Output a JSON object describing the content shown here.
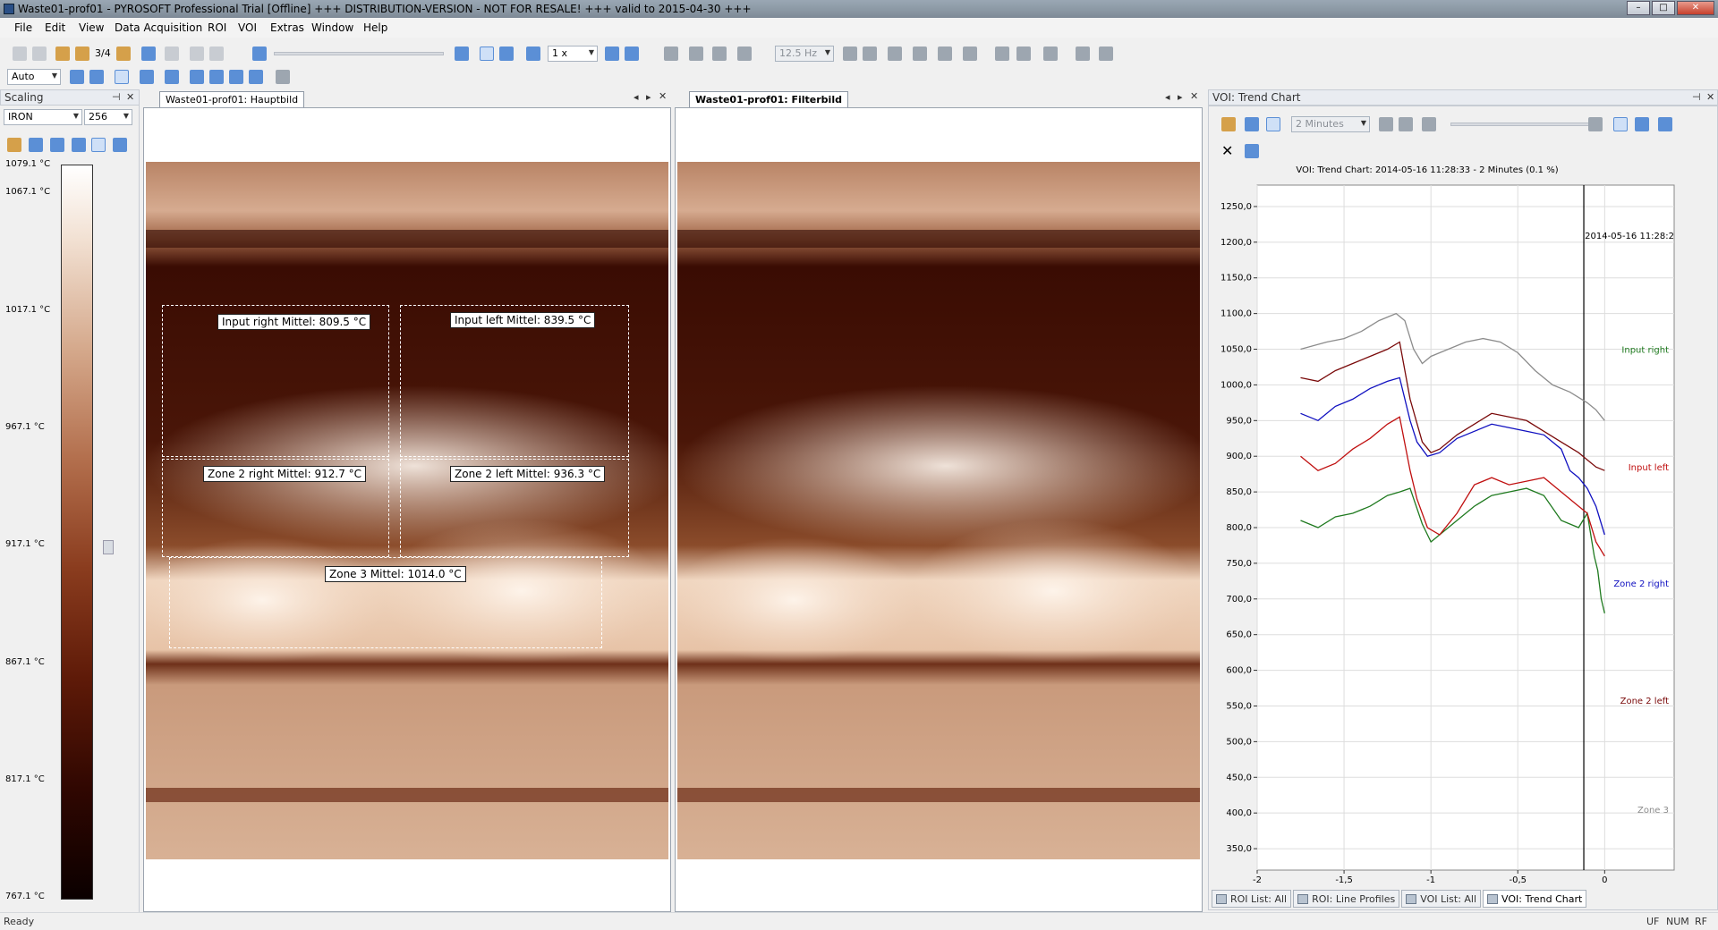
{
  "window": {
    "title": "Waste01-prof01 - PYROSOFT Professional Trial [Offline] +++ DISTRIBUTION-VERSION - NOT FOR RESALE! +++ valid to 2015-04-30 +++"
  },
  "menu": [
    "File",
    "Edit",
    "View",
    "Data Acquisition",
    "ROI",
    "VOI",
    "Extras",
    "Window",
    "Help"
  ],
  "toolbar": {
    "frame_counter": "3/4",
    "speed": "1 x",
    "rate": "12.5 Hz",
    "zoom_mode": "Auto"
  },
  "scaling": {
    "title": "Scaling",
    "palette": "IRON",
    "levels": "256",
    "ticks": [
      "1079.1 °C",
      "1067.1 °C",
      "1017.1 °C",
      "967.1 °C",
      "917.1 °C",
      "867.1 °C",
      "817.1 °C",
      "767.1 °C"
    ]
  },
  "views": {
    "main_tab": "Waste01-prof01: Hauptbild",
    "filter_tab": "Waste01-prof01: Filterbild"
  },
  "rois": [
    {
      "label": "Input right Mittel: 809.5 °C"
    },
    {
      "label": "Input left Mittel: 839.5 °C"
    },
    {
      "label": "Zone 2 right Mittel: 912.7 °C"
    },
    {
      "label": "Zone 2 left Mittel: 936.3 °C"
    },
    {
      "label": "Zone 3 Mittel: 1014.0 °C"
    }
  ],
  "trend": {
    "panel_title": "VOI: Trend Chart",
    "interval": "2 Minutes"
  },
  "chart_data": {
    "type": "line",
    "title": "VOI: Trend Chart: 2014-05-16 11:28:33 - 2 Minutes (0.1 %)",
    "cursor_label": "2014-05-16 11:28:2",
    "cursor_x": -0.12,
    "xlim": [
      -2,
      0.4
    ],
    "ylim": [
      320,
      1280
    ],
    "x_ticks": [
      "-2",
      "-1,5",
      "-1",
      "-0,5",
      "0"
    ],
    "x_tick_values": [
      -2,
      -1.5,
      -1,
      -0.5,
      0
    ],
    "y_ticks": [
      "1250,0",
      "1200,0",
      "1150,0",
      "1100,0",
      "1050,0",
      "1000,0",
      "950,0",
      "900,0",
      "850,0",
      "800,0",
      "750,0",
      "700,0",
      "650,0",
      "600,0",
      "550,0",
      "500,0",
      "450,0",
      "400,0",
      "350,0"
    ],
    "y_tick_values": [
      1250,
      1200,
      1150,
      1100,
      1050,
      1000,
      950,
      900,
      850,
      800,
      750,
      700,
      650,
      600,
      550,
      500,
      450,
      400,
      350
    ],
    "series": [
      {
        "name": "Zone 3",
        "color": "#8c8c8c",
        "label_y": 400,
        "x": [
          -1.75,
          -1.6,
          -1.5,
          -1.4,
          -1.3,
          -1.2,
          -1.15,
          -1.1,
          -1.05,
          -1.0,
          -0.9,
          -0.8,
          -0.7,
          -0.6,
          -0.5,
          -0.4,
          -0.3,
          -0.2,
          -0.1,
          -0.05,
          0.0
        ],
        "y": [
          1050,
          1060,
          1065,
          1075,
          1090,
          1100,
          1090,
          1050,
          1030,
          1040,
          1050,
          1060,
          1065,
          1060,
          1045,
          1020,
          1000,
          990,
          975,
          965,
          950
        ]
      },
      {
        "name": "Input right",
        "color": "#1f7a1f",
        "label_y": 1045,
        "x": [
          -1.75,
          -1.65,
          -1.55,
          -1.45,
          -1.35,
          -1.25,
          -1.18,
          -1.12,
          -1.05,
          -1.0,
          -0.95,
          -0.85,
          -0.75,
          -0.65,
          -0.55,
          -0.45,
          -0.35,
          -0.25,
          -0.15,
          -0.1,
          -0.06,
          -0.04,
          -0.02,
          0.0
        ],
        "y": [
          810,
          800,
          815,
          820,
          830,
          845,
          850,
          855,
          805,
          780,
          790,
          810,
          830,
          845,
          850,
          855,
          845,
          810,
          800,
          820,
          760,
          740,
          700,
          680
        ]
      },
      {
        "name": "Input left",
        "color": "#c01010",
        "label_y": 880,
        "x": [
          -1.75,
          -1.65,
          -1.55,
          -1.45,
          -1.35,
          -1.25,
          -1.18,
          -1.12,
          -1.08,
          -1.02,
          -0.95,
          -0.85,
          -0.75,
          -0.65,
          -0.55,
          -0.45,
          -0.35,
          -0.25,
          -0.15,
          -0.1,
          -0.05,
          0.0
        ],
        "y": [
          900,
          880,
          890,
          910,
          925,
          945,
          955,
          880,
          840,
          800,
          790,
          820,
          860,
          870,
          860,
          865,
          870,
          850,
          830,
          820,
          780,
          760
        ]
      },
      {
        "name": "Zone 2 right",
        "color": "#1010c0",
        "label_y": 717,
        "x": [
          -1.75,
          -1.65,
          -1.55,
          -1.45,
          -1.35,
          -1.25,
          -1.18,
          -1.12,
          -1.08,
          -1.02,
          -0.95,
          -0.85,
          -0.75,
          -0.65,
          -0.55,
          -0.45,
          -0.35,
          -0.25,
          -0.2,
          -0.15,
          -0.1,
          -0.05,
          0.0
        ],
        "y": [
          960,
          950,
          970,
          980,
          995,
          1005,
          1010,
          950,
          920,
          900,
          905,
          925,
          935,
          945,
          940,
          935,
          930,
          910,
          880,
          870,
          855,
          830,
          790
        ]
      },
      {
        "name": "Zone 2 left",
        "color": "#7a0a0a",
        "label_y": 553,
        "x": [
          -1.75,
          -1.65,
          -1.55,
          -1.45,
          -1.35,
          -1.25,
          -1.18,
          -1.12,
          -1.05,
          -1.0,
          -0.95,
          -0.85,
          -0.75,
          -0.65,
          -0.55,
          -0.45,
          -0.35,
          -0.25,
          -0.15,
          -0.1,
          -0.05,
          0.0
        ],
        "y": [
          1010,
          1005,
          1020,
          1030,
          1040,
          1050,
          1060,
          980,
          920,
          905,
          910,
          930,
          945,
          960,
          955,
          950,
          935,
          920,
          905,
          895,
          885,
          880
        ]
      }
    ]
  },
  "bottom_tabs": [
    "ROI List: All",
    "ROI: Line Profiles",
    "VOI List: All",
    "VOI: Trend Chart"
  ],
  "status": {
    "left": "Ready",
    "right": [
      "UF",
      "NUM",
      "RF"
    ]
  }
}
